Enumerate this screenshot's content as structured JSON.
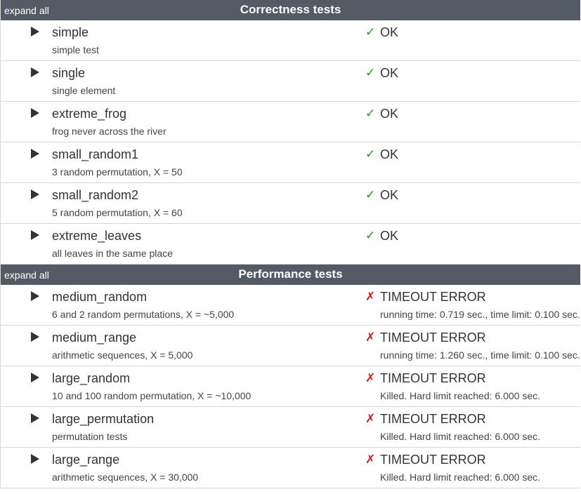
{
  "sections": [
    {
      "expand_label": "expand all",
      "title": "Correctness tests",
      "tests": [
        {
          "name": "simple",
          "description": "simple test",
          "status": "OK",
          "detail": "",
          "result": "ok"
        },
        {
          "name": "single",
          "description": "single element",
          "status": "OK",
          "detail": "",
          "result": "ok"
        },
        {
          "name": "extreme_frog",
          "description": "frog never across the river",
          "status": "OK",
          "detail": "",
          "result": "ok"
        },
        {
          "name": "small_random1",
          "description": "3 random permutation, X = 50",
          "status": "OK",
          "detail": "",
          "result": "ok"
        },
        {
          "name": "small_random2",
          "description": "5 random permutation, X = 60",
          "status": "OK",
          "detail": "",
          "result": "ok"
        },
        {
          "name": "extreme_leaves",
          "description": "all leaves in the same place",
          "status": "OK",
          "detail": "",
          "result": "ok"
        }
      ]
    },
    {
      "expand_label": "expand all",
      "title": "Performance tests",
      "tests": [
        {
          "name": "medium_random",
          "description": "6 and 2 random permutations, X = ~5,000",
          "status": "TIMEOUT ERROR",
          "detail": "running time: 0.719 sec., time limit: 0.100 sec.",
          "result": "error"
        },
        {
          "name": "medium_range",
          "description": "arithmetic sequences, X = 5,000",
          "status": "TIMEOUT ERROR",
          "detail": "running time: 1.260 sec., time limit: 0.100 sec.",
          "result": "error"
        },
        {
          "name": "large_random",
          "description": "10 and 100 random permutation, X = ~10,000",
          "status": "TIMEOUT ERROR",
          "detail": "Killed. Hard limit reached: 6.000 sec.",
          "result": "error"
        },
        {
          "name": "large_permutation",
          "description": "permutation tests",
          "status": "TIMEOUT ERROR",
          "detail": "Killed. Hard limit reached: 6.000 sec.",
          "result": "error"
        },
        {
          "name": "large_range",
          "description": "arithmetic sequences, X = 30,000",
          "status": "TIMEOUT ERROR",
          "detail": "Killed. Hard limit reached: 6.000 sec.",
          "result": "error"
        }
      ]
    }
  ],
  "icons": {
    "ok": "check-mark-icon",
    "error": "cross-mark-icon",
    "toggle": "play-triangle-icon"
  },
  "colors": {
    "header_bg": "#545b64",
    "ok": "#1aa11a",
    "error": "#d31c1c"
  }
}
